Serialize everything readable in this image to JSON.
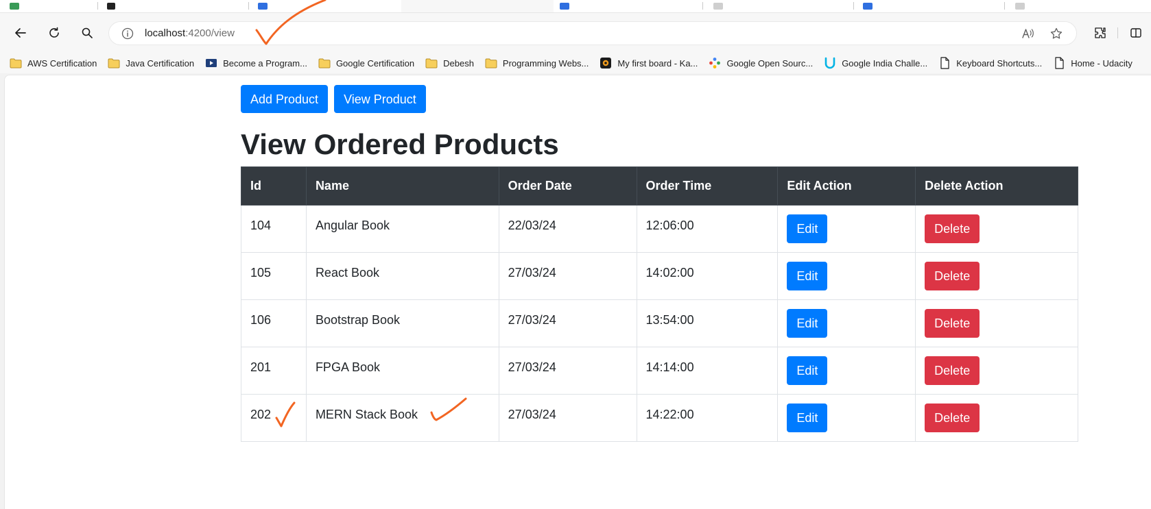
{
  "browser": {
    "address": {
      "host": "localhost",
      "path": ":4200/view"
    },
    "bookmarks": [
      {
        "label": "AWS Certification",
        "icon": "folder-icon"
      },
      {
        "label": "Java Certification",
        "icon": "folder-icon"
      },
      {
        "label": "Become a Program...",
        "icon": "video-icon"
      },
      {
        "label": "Google Certification",
        "icon": "folder-icon"
      },
      {
        "label": "Debesh",
        "icon": "folder-icon"
      },
      {
        "label": "Programming Webs...",
        "icon": "folder-icon"
      },
      {
        "label": "My first board - Ka...",
        "icon": "app-icon"
      },
      {
        "label": "Google Open Sourc...",
        "icon": "gem-icon"
      },
      {
        "label": "Google India Challe...",
        "icon": "udacity-icon"
      },
      {
        "label": "Keyboard Shortcuts...",
        "icon": "page-icon"
      },
      {
        "label": "Home - Udacity",
        "icon": "page-icon"
      }
    ]
  },
  "page": {
    "add_product_label": "Add Product",
    "view_product_label": "View Product",
    "title": "View Ordered Products",
    "table": {
      "headers": [
        "Id",
        "Name",
        "Order Date",
        "Order Time",
        "Edit Action",
        "Delete Action"
      ],
      "edit_label": "Edit",
      "delete_label": "Delete",
      "rows": [
        {
          "id": "104",
          "name": "Angular Book",
          "date": "22/03/24",
          "time": "12:06:00"
        },
        {
          "id": "105",
          "name": "React Book",
          "date": "27/03/24",
          "time": "14:02:00"
        },
        {
          "id": "106",
          "name": "Bootstrap Book",
          "date": "27/03/24",
          "time": "13:54:00"
        },
        {
          "id": "201",
          "name": "FPGA Book",
          "date": "27/03/24",
          "time": "14:14:00"
        },
        {
          "id": "202",
          "name": "MERN Stack Book",
          "date": "27/03/24",
          "time": "14:22:00"
        }
      ]
    }
  },
  "colors": {
    "primary": "#007bff",
    "danger": "#dc3545",
    "table_header": "#343a40",
    "annotation": "#f26522"
  }
}
